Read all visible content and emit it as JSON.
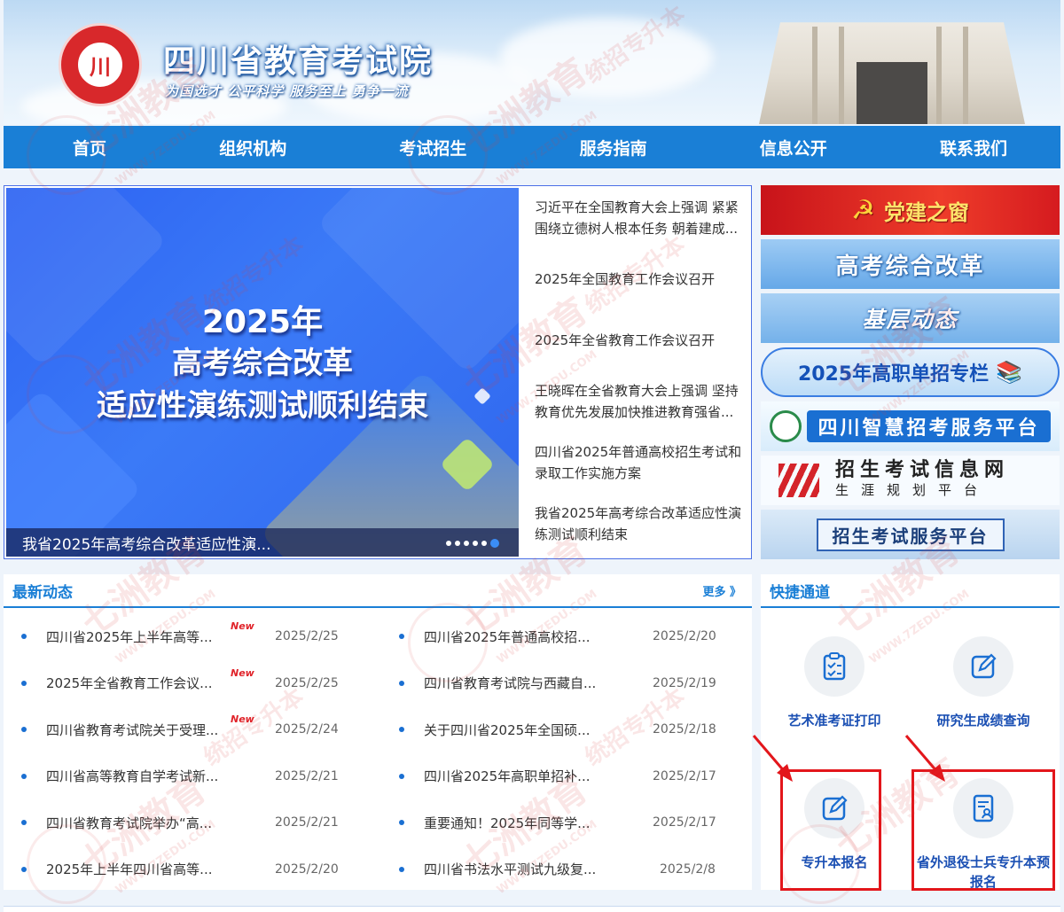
{
  "header": {
    "logo_text": "川",
    "title": "四川省教育考试院",
    "motto": "为国选才  公平科学  服务至上  勇争一流"
  },
  "nav": {
    "items": [
      "首页",
      "组织机构",
      "考试招生",
      "服务指南",
      "信息公开",
      "联系我们"
    ]
  },
  "slider": {
    "headline_year": "2025年",
    "headline_line2": "高考综合改革",
    "headline_line3": "适应性演练测试顺利结束",
    "caption": "我省2025年高考综合改革适应性演...",
    "slide_count": 6,
    "active_slide": 6
  },
  "headlines": [
    "习近平在全国教育大会上强调 紧紧围绕立德树人根本任务 朝着建成...",
    "2025年全国教育工作会议召开",
    "2025年全省教育工作会议召开",
    "王晓晖在全省教育大会上强调 坚持教育优先发展加快推进教育强省...",
    "四川省2025年普通高校招生考试和录取工作实施方案",
    "我省2025年高考综合改革适应性演练测试顺利结束"
  ],
  "banners": {
    "party": "党建之窗",
    "gaokao_reform": "高考综合改革",
    "grassroots": "基层动态",
    "vocational": "2025年高职单招专栏",
    "smart_platform": "四川智慧招考服务平台",
    "info_net_line1": "招生考试信息网",
    "info_net_line2": "生涯规划平台",
    "service_platform": "招生考试服务平台"
  },
  "news": {
    "title": "最新动态",
    "more": "更多 》",
    "new_tag": "New",
    "left": [
      {
        "text": "四川省2025年上半年高等...",
        "date": "2025/2/25",
        "new": true
      },
      {
        "text": "2025年全省教育工作会议...",
        "date": "2025/2/25",
        "new": true
      },
      {
        "text": "四川省教育考试院关于受理...",
        "date": "2025/2/24",
        "new": true
      },
      {
        "text": "四川省高等教育自学考试新...",
        "date": "2025/2/21",
        "new": false
      },
      {
        "text": "四川省教育考试院举办“高...",
        "date": "2025/2/21",
        "new": false
      },
      {
        "text": "2025年上半年四川省高等...",
        "date": "2025/2/20",
        "new": false
      }
    ],
    "right": [
      {
        "text": "四川省2025年普通高校招...",
        "date": "2025/2/20"
      },
      {
        "text": "四川省教育考试院与西藏自...",
        "date": "2025/2/19"
      },
      {
        "text": "关于四川省2025年全国硕...",
        "date": "2025/2/18"
      },
      {
        "text": "四川省2025年高职单招补...",
        "date": "2025/2/17"
      },
      {
        "text": "重要通知！2025年同等学...",
        "date": "2025/2/17"
      },
      {
        "text": "四川省书法水平测试九级复...",
        "date": "2025/2/8"
      }
    ]
  },
  "quick": {
    "title": "快捷通道",
    "items": [
      "艺术准考证打印",
      "研究生成绩查询",
      "专升本报名",
      "省外退役士兵专升本预报名"
    ]
  },
  "watermark": {
    "brand": "七洲教育",
    "url": "WWW.7ZEDU.COM",
    "side": "统招专升本"
  },
  "colors": {
    "nav_blue": "#1a7fd6",
    "accent_red": "#e3161b",
    "link_blue": "#1a4fb3"
  }
}
